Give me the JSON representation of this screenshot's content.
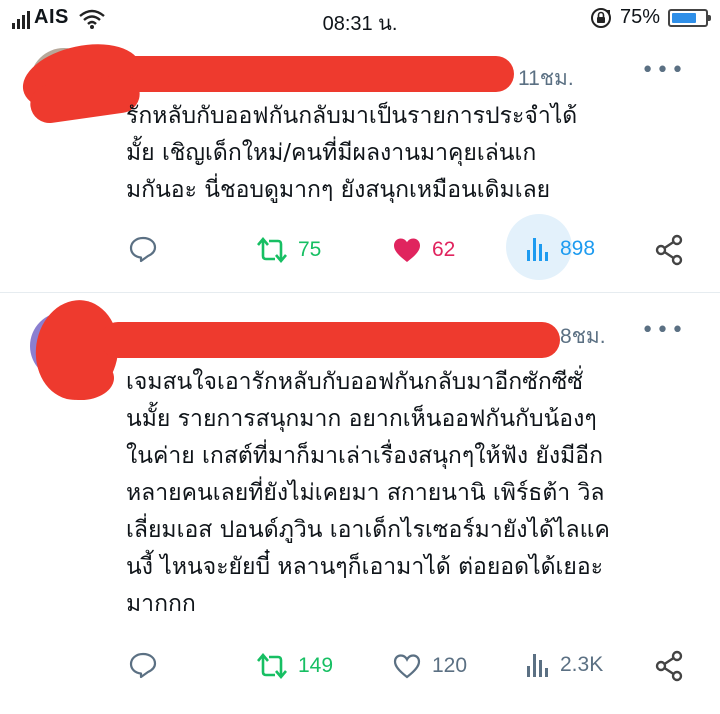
{
  "status_bar": {
    "carrier": "AIS",
    "time": "08:31 น.",
    "battery": "75%",
    "battery_level": 0.75,
    "icons": [
      "signal-icon",
      "wifi-icon",
      "rotation-lock-icon",
      "battery-icon"
    ]
  },
  "tweets": [
    {
      "time": "11ชม.",
      "lines": [
        "รักหลับกับออฟกันกลับมาเป็นรายการประจำได้",
        "มั้ย เชิญเด็กใหม่/คนที่มีผลงานมาคุยเล่นเก",
        "มกันอะ นี่ชอบดูมากๆ ยังสนุกเหมือนเดิมเลย"
      ],
      "retweets": "75",
      "likes": "62",
      "views": "898",
      "liked": true
    },
    {
      "time": "8ชม.",
      "lines": [
        "เจมสนใจเอารักหลับกับออฟกันกลับมาอีกซักซีซั่",
        "นมั้ย รายการสนุกมาก อยากเห็นออฟกันกับน้องๆ",
        "ในค่าย เกสต์ที่มาก็มาเล่าเรื่องสนุกๆให้ฟัง ยังมีอีก",
        "หลายคนเลยที่ยังไม่เคยมา สกายนานิ เพิร์ธต้า วิล",
        "เลี่ยมเอส ปอนด์ภูวิน เอาเด็กไรเซอร์มายังได้ไลแค",
        "นงี้ ไหนจะยัยบี๋ หลานๆก็เอามาได้ ต่อยอดได้เยอะ",
        "มากกก"
      ],
      "retweets": "149",
      "likes": "120",
      "views": "2.3K",
      "liked": false
    }
  ],
  "colors": {
    "accent": "#1d9bf0",
    "retweet": "#17bf63",
    "like": "#e0245e",
    "muted": "#5b7083",
    "redaction": "#ee3a2e"
  }
}
